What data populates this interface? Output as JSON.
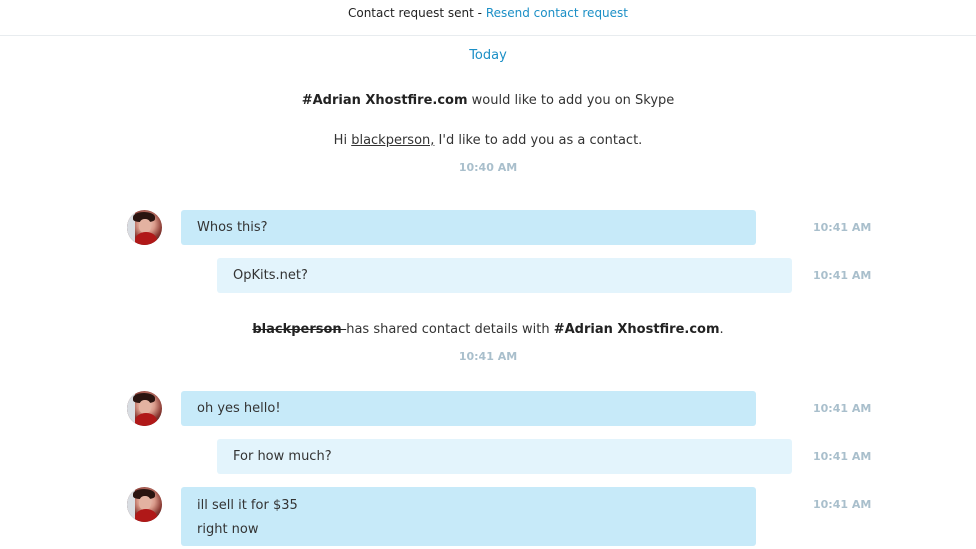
{
  "topbar": {
    "status_text": "Contact request sent - ",
    "resend_link": "Resend contact request"
  },
  "conversation": {
    "date_divider": "Today",
    "request": {
      "sender": "#Adrian Xhostfire.com",
      "text": " would like to add you on Skype",
      "greeting_prefix": "Hi ",
      "greeting_name": "blackperson,",
      "greeting_suffix": " I'd like to add you as a contact.",
      "time": "10:40 AM"
    },
    "shared": {
      "from": "blackperson ",
      "middle": "has shared contact details with ",
      "to": "#Adrian Xhostfire.com",
      "end": ".",
      "time": "10:41 AM"
    },
    "messages": [
      {
        "direction": "in",
        "lines": [
          "Whos this?"
        ],
        "time": "10:41 AM"
      },
      {
        "direction": "out",
        "lines": [
          "OpKits.net?"
        ],
        "time": "10:41 AM"
      },
      {
        "direction": "in",
        "lines": [
          "oh yes hello!"
        ],
        "time": "10:41 AM"
      },
      {
        "direction": "out",
        "lines": [
          "For how much?"
        ],
        "time": "10:41 AM"
      },
      {
        "direction": "in",
        "lines": [
          "ill sell it for $35",
          "right now"
        ],
        "time": "10:41 AM"
      }
    ]
  }
}
